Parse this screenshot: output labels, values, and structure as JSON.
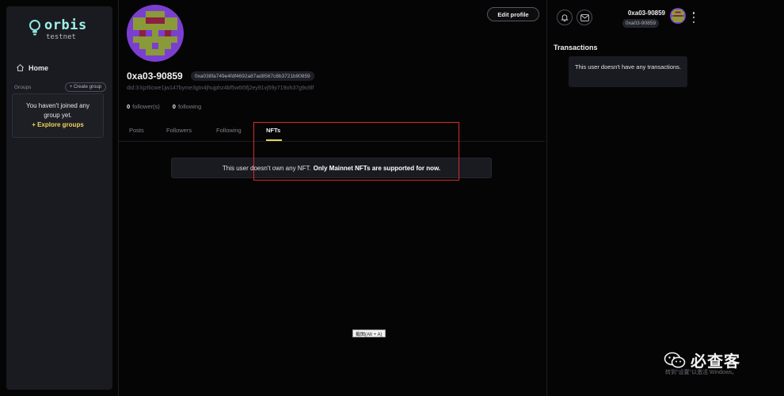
{
  "brand": {
    "name": "orbis",
    "env": "testnet"
  },
  "sidebar": {
    "home_label": "Home",
    "groups_label": "Groups",
    "create_group": "+ Create group",
    "groups_empty": "You haven't joined any group yet.",
    "explore_groups": "+ Explore groups"
  },
  "profile": {
    "edit_profile": "Edit profile",
    "username": "0xa03-90859",
    "address": "0xa038fa749e4fdf4692a87ad8567c8b3721b90859",
    "did": "did:3:kjzl6cwe1jw147byme3gtn4jhujphz4bf5w6t5fj2ey91vj59y719oh37g9o9lf",
    "followers_count": "0",
    "followers_label": "follower(s)",
    "following_count": "0",
    "following_label": "following"
  },
  "tabs": {
    "posts": "Posts",
    "followers": "Followers",
    "following": "Following",
    "nfts": "NFTs",
    "active": "nfts"
  },
  "nft_notice": {
    "main": "This user doesn't own any NFT.",
    "bold": "Only Mainnet NFTs are supported for now."
  },
  "header_user": {
    "name": "0xa03-90859",
    "chip": "0xa03-90859"
  },
  "transactions": {
    "title": "Transactions",
    "empty": "This user doesn't have any transactions."
  },
  "overlay": {
    "screenshot_tip": "截图(Alt + A)",
    "watermark": "必查客",
    "windows_note": "转到\"设置\"以激活 Windows。"
  },
  "colors": {
    "accent": "#e8d35a",
    "brand": "#9ff0e8",
    "highlight": "#d72a2a",
    "avatar_purple": "#7b3fd0",
    "avatar_olive": "#8a9a38",
    "avatar_maroon": "#8b2040"
  },
  "icons": {
    "home": "home-icon",
    "bell": "bell-icon",
    "mail": "mail-icon",
    "more": "kebab-menu-icon"
  }
}
